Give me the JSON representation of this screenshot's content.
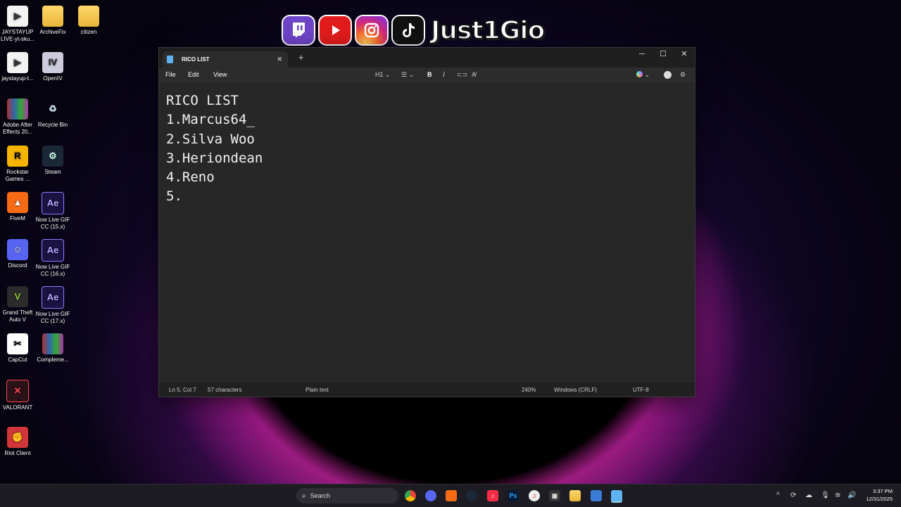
{
  "desktop": {
    "icons": [
      {
        "label": "JAYSTAYUP LIVE-yt-sku...",
        "icon": "document-icon"
      },
      {
        "label": "ArchiveFix",
        "icon": "folder-icon"
      },
      {
        "label": "citizen",
        "icon": "folder-icon"
      },
      {
        "label": "jaystayup-t...",
        "icon": "document-icon"
      },
      {
        "label": "OpenIV",
        "icon": "openiv-icon"
      },
      {
        "label": "Adobe After Effects 20...",
        "icon": "winrar-icon"
      },
      {
        "label": "Recycle Bin",
        "icon": "recycle-bin-icon"
      },
      {
        "label": "Rockstar Games ...",
        "icon": "rockstar-icon"
      },
      {
        "label": "Steam",
        "icon": "steam-icon"
      },
      {
        "label": "FiveM",
        "icon": "fivem-icon"
      },
      {
        "label": "Now Live GIF CC (15.x)",
        "icon": "after-effects-icon"
      },
      {
        "label": "Discord",
        "icon": "discord-icon"
      },
      {
        "label": "Now Live GIF CC (16.x)",
        "icon": "after-effects-icon"
      },
      {
        "label": "Grand Theft Auto V",
        "icon": "gta-icon"
      },
      {
        "label": "Now Live GIF CC (17.x)",
        "icon": "after-effects-icon"
      },
      {
        "label": "CapCut",
        "icon": "capcut-icon"
      },
      {
        "label": "Compleme...",
        "icon": "winrar-icon"
      },
      {
        "label": "VALORANT",
        "icon": "valorant-icon"
      },
      {
        "label": "Riot Client",
        "icon": "riot-icon"
      }
    ],
    "glyphs": {
      "ae": "Ae",
      "openiv": "IV",
      "rockstar": "R",
      "gta": "V",
      "riot": "✊"
    }
  },
  "banner": {
    "handle": "Just1Gio"
  },
  "notepad": {
    "tab_title": "RICO LIST",
    "menu": {
      "file": "File",
      "edit": "Edit",
      "view": "View"
    },
    "format": {
      "heading": "H1"
    },
    "content": [
      "RICO LIST",
      "1.Marcus64_",
      "2.Silva Woo",
      "3.Heriondean",
      "4.Reno",
      "5."
    ],
    "status": {
      "position": "Ln 5, Col 7",
      "characters": "57 characters",
      "mode": "Plain text",
      "zoom": "240%",
      "line_ending": "Windows (CRLF)",
      "encoding": "UTF-8"
    }
  },
  "taskbar": {
    "search_placeholder": "Search",
    "time": "3:37 PM",
    "date": "12/31/2025"
  },
  "colors": {
    "accent": "#5fb3f0",
    "window_bg": "#272727",
    "taskbar_bg": "#1c1c22"
  }
}
